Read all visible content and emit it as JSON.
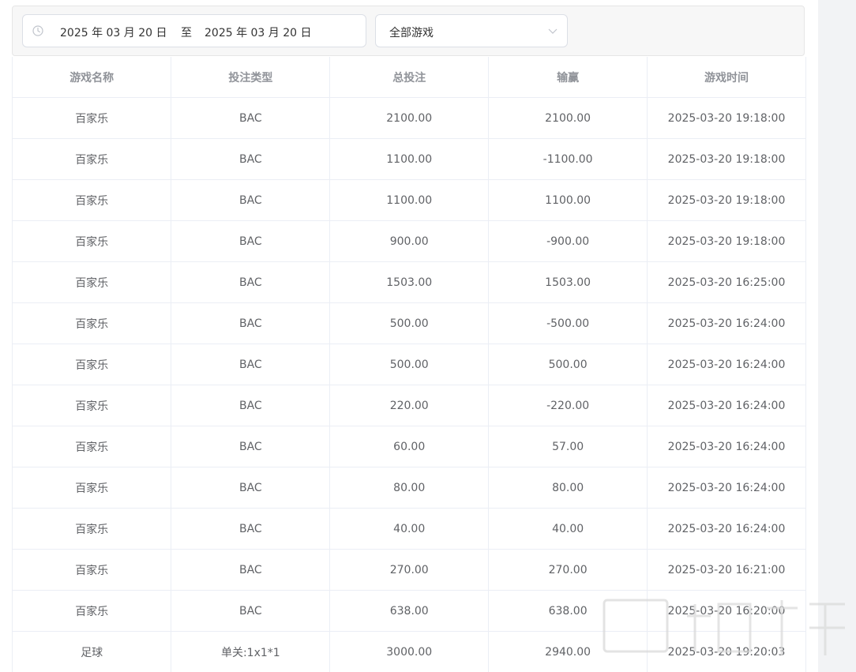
{
  "filters": {
    "date_start": "2025 年 03 月 20 日",
    "date_separator": "至",
    "date_end": "2025 年 03 月 20 日",
    "game_select_value": "全部游戏"
  },
  "table": {
    "headers": [
      "游戏名称",
      "投注类型",
      "总投注",
      "输赢",
      "游戏时间"
    ],
    "rows": [
      [
        "百家乐",
        "BAC",
        "2100.00",
        "2100.00",
        "2025-03-20 19:18:00"
      ],
      [
        "百家乐",
        "BAC",
        "1100.00",
        "-1100.00",
        "2025-03-20 19:18:00"
      ],
      [
        "百家乐",
        "BAC",
        "1100.00",
        "1100.00",
        "2025-03-20 19:18:00"
      ],
      [
        "百家乐",
        "BAC",
        "900.00",
        "-900.00",
        "2025-03-20 19:18:00"
      ],
      [
        "百家乐",
        "BAC",
        "1503.00",
        "1503.00",
        "2025-03-20 16:25:00"
      ],
      [
        "百家乐",
        "BAC",
        "500.00",
        "-500.00",
        "2025-03-20 16:24:00"
      ],
      [
        "百家乐",
        "BAC",
        "500.00",
        "500.00",
        "2025-03-20 16:24:00"
      ],
      [
        "百家乐",
        "BAC",
        "220.00",
        "-220.00",
        "2025-03-20 16:24:00"
      ],
      [
        "百家乐",
        "BAC",
        "60.00",
        "57.00",
        "2025-03-20 16:24:00"
      ],
      [
        "百家乐",
        "BAC",
        "80.00",
        "80.00",
        "2025-03-20 16:24:00"
      ],
      [
        "百家乐",
        "BAC",
        "40.00",
        "40.00",
        "2025-03-20 16:24:00"
      ],
      [
        "百家乐",
        "BAC",
        "270.00",
        "270.00",
        "2025-03-20 16:21:00"
      ],
      [
        "百家乐",
        "BAC",
        "638.00",
        "638.00",
        "2025-03-20 16:20:00"
      ],
      [
        "足球",
        "单关:1x1*1",
        "3000.00",
        "2940.00",
        "2025-03-20 19:20:03"
      ]
    ]
  }
}
